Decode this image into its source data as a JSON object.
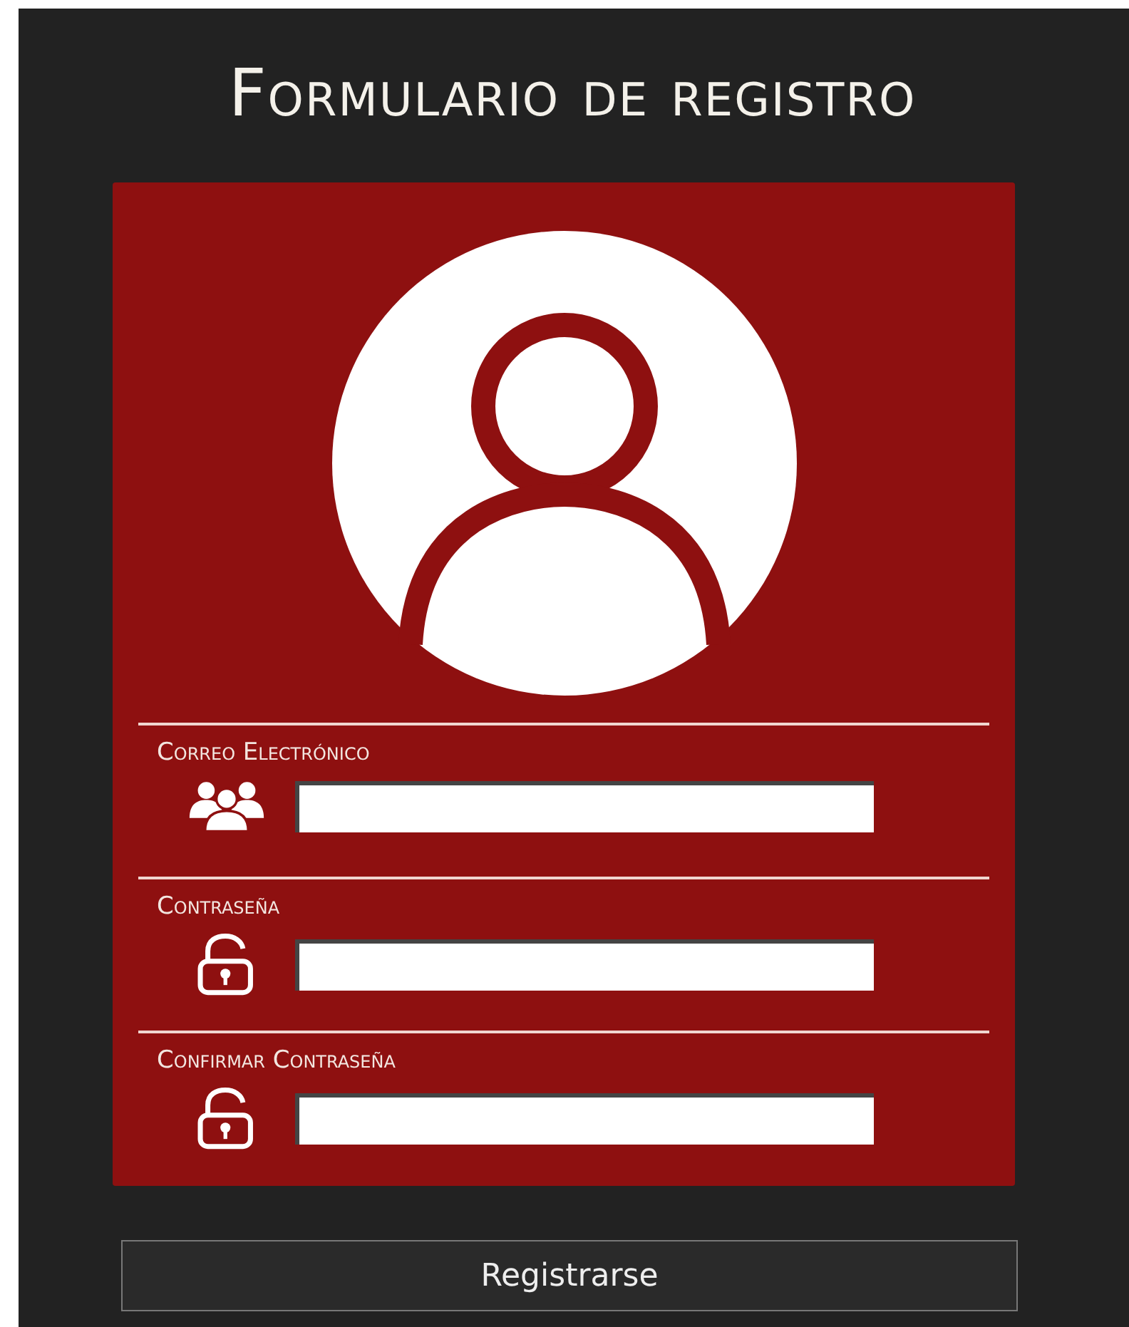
{
  "title": "Formulario de registro",
  "fields": [
    {
      "label": "Correo Electrónico",
      "kind": "users"
    },
    {
      "label": "Contraseña",
      "kind": "lock"
    },
    {
      "label": "Confirmar Contraseña",
      "kind": "lock"
    }
  ],
  "button": "Registrarse"
}
